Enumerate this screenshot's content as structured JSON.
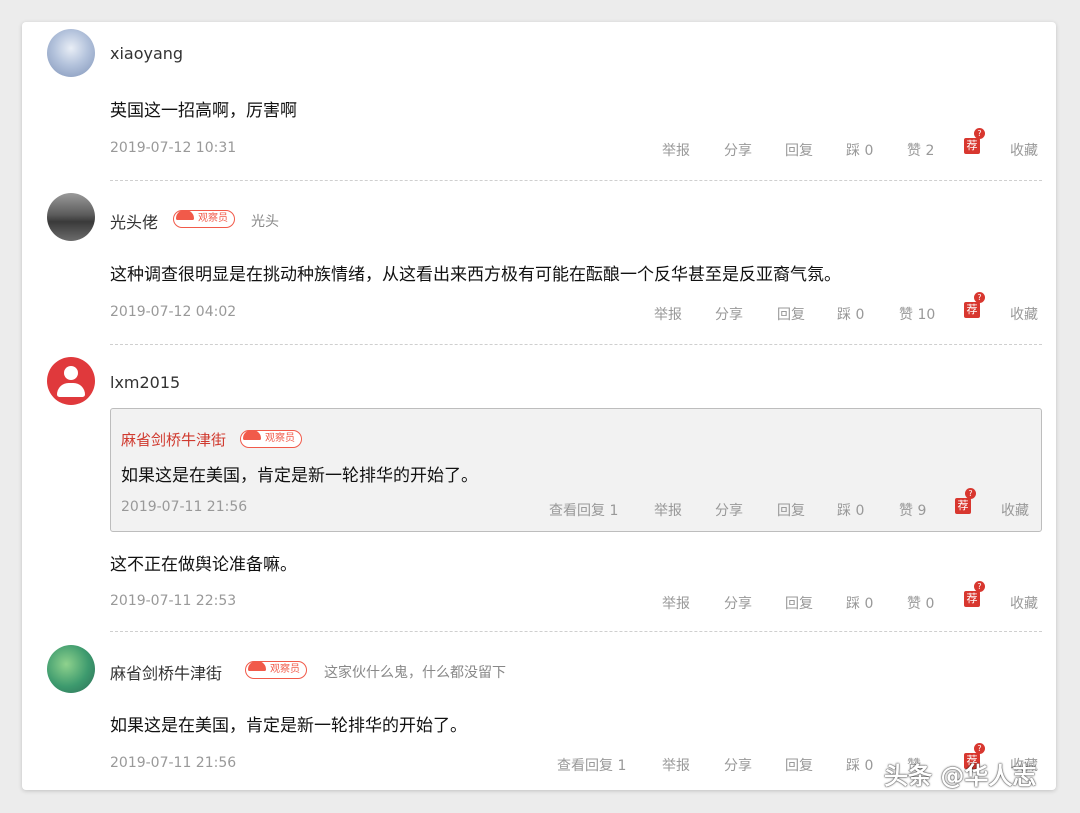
{
  "comments": [
    {
      "username": "xiaoyang",
      "text": "英国这一招高啊，厉害啊",
      "time": "2019-07-12 10:31",
      "actions": {
        "report": "举报",
        "share": "分享",
        "reply": "回复",
        "dislike": "踩 0",
        "like": "赞 2",
        "rec": "荐",
        "rec_q": "?",
        "fav": "收藏"
      }
    },
    {
      "username": "光头佬",
      "badge": "观察员",
      "signature": "光头",
      "text": "这种调查很明显是在挑动种族情绪，从这看出来西方极有可能在酝酿一个反华甚至是反亚裔气氛。",
      "time": "2019-07-12 04:02",
      "actions": {
        "report": "举报",
        "share": "分享",
        "reply": "回复",
        "dislike": "踩 0",
        "like": "赞 10",
        "rec": "荐",
        "rec_q": "?",
        "fav": "收藏"
      }
    },
    {
      "username": "lxm2015",
      "quote": {
        "username": "麻省剑桥牛津街",
        "badge": "观察员",
        "text": "如果这是在美国，肯定是新一轮排华的开始了。",
        "time": "2019-07-11 21:56",
        "actions": {
          "view_replies": "查看回复 1",
          "report": "举报",
          "share": "分享",
          "reply": "回复",
          "dislike": "踩 0",
          "like": "赞 9",
          "rec": "荐",
          "rec_q": "?",
          "fav": "收藏"
        }
      },
      "text": "这不正在做舆论准备嘛。",
      "time": "2019-07-11 22:53",
      "actions": {
        "report": "举报",
        "share": "分享",
        "reply": "回复",
        "dislike": "踩 0",
        "like": "赞 0",
        "rec": "荐",
        "rec_q": "?",
        "fav": "收藏"
      }
    },
    {
      "username": "麻省剑桥牛津街",
      "badge": "观察员",
      "signature": "这家伙什么鬼，什么都没留下",
      "text": "如果这是在美国，肯定是新一轮排华的开始了。",
      "time": "2019-07-11 21:56",
      "actions": {
        "view_replies": "查看回复 1",
        "report": "举报",
        "share": "分享",
        "reply": "回复",
        "dislike": "踩 0",
        "like": "赞 ",
        "rec": "荐",
        "rec_q": "?",
        "fav": "收藏"
      }
    }
  ],
  "watermark": "头条 @华人志",
  "colors": {
    "badge": "#f15a4a",
    "rec": "#d8372f",
    "quote_name": "#d03a2f",
    "meta": "#999999"
  }
}
